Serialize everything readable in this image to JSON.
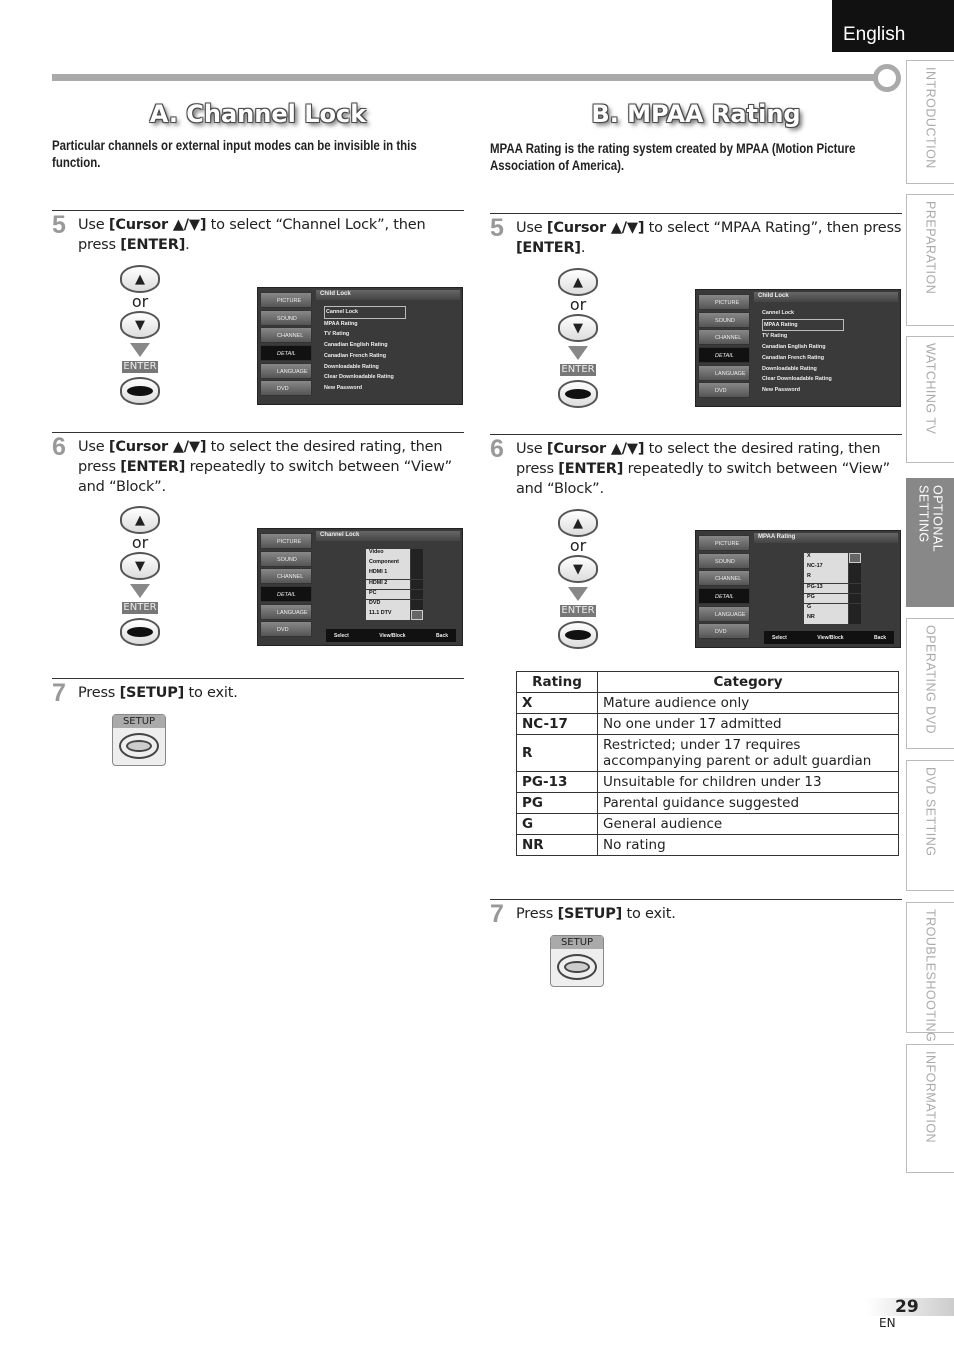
{
  "header": {
    "language": "English"
  },
  "side_tabs": [
    {
      "label": "INTRODUCTION",
      "active": false
    },
    {
      "label": "PREPARATION",
      "active": false
    },
    {
      "label": "WATCHING TV",
      "active": false
    },
    {
      "label": "OPTIONAL SETTING",
      "active": true
    },
    {
      "label": "OPERATING DVD",
      "active": false
    },
    {
      "label": "DVD SETTING",
      "active": false
    },
    {
      "label": "TROUBLESHOOTING",
      "active": false
    },
    {
      "label": "INFORMATION",
      "active": false
    }
  ],
  "remote": {
    "or": "or",
    "enter": "ENTER",
    "setup": "SETUP"
  },
  "menu_side": [
    "PICTURE",
    "SOUND",
    "CHANNEL",
    "DETAIL",
    "LANGUAGE",
    "DVD"
  ],
  "menu_footer": {
    "select": "Select",
    "viewblock": "View/Block",
    "back": "Back",
    "back_tag": "BACK"
  },
  "sectionA": {
    "title": "A.  Channel Lock",
    "intro": "Particular channels or external input modes can be invisible in this function.",
    "step5": {
      "num": "5",
      "pre": "Use ",
      "b1": "[Cursor ▲/▼]",
      "mid": " to select “Channel Lock”, then press ",
      "b2": "[ENTER]",
      "post": "."
    },
    "screen1": {
      "title": "Child Lock",
      "items": [
        "Cannel Lock",
        "MPAA Rating",
        "TV Rating",
        "Canadian English Rating",
        "Canadian French Rating",
        "Downloadable Rating",
        "Clear Downloadable Rating",
        "New Password"
      ]
    },
    "step6": {
      "num": "6",
      "pre": "Use ",
      "b1": "[Cursor ▲/▼]",
      "mid": " to select the desired rating, then press ",
      "b2": "[ENTER]",
      "post": " repeatedly to switch between “View” and “Block”."
    },
    "screen2": {
      "title": "Channel Lock",
      "items": [
        "Video",
        "Component",
        "HDMI 1",
        "HDMI 2",
        "PC",
        "DVD",
        "11.1 DTV"
      ]
    },
    "step7": {
      "num": "7",
      "pre": "Press ",
      "b1": "[SETUP]",
      "post": " to exit."
    }
  },
  "sectionB": {
    "title": "B. MPAA Rating",
    "intro": "MPAA Rating is the rating system created by MPAA (Motion Picture Association of America).",
    "step5": {
      "num": "5",
      "pre": "Use ",
      "b1": "[Cursor ▲/▼]",
      "mid": " to select “MPAA Rating”, then press ",
      "b2": "[ENTER]",
      "post": "."
    },
    "screen1": {
      "title": "Child Lock",
      "items": [
        "Cannel Lock",
        "MPAA Rating",
        "TV Rating",
        "Canadian English Rating",
        "Canadian French Rating",
        "Downloadable Rating",
        "Clear Downloadable Rating",
        "New Password"
      ]
    },
    "step6": {
      "num": "6",
      "pre": "Use ",
      "b1": "[Cursor ▲/▼]",
      "mid": " to select the desired rating, then press ",
      "b2": "[ENTER]",
      "post": " repeatedly to switch between “View” and “Block”."
    },
    "screen2": {
      "title": "MPAA Rating",
      "items": [
        "X",
        "NC-17",
        "R",
        "PG-13",
        "PG",
        "G",
        "NR"
      ]
    },
    "table": {
      "headers": [
        "Rating",
        "Category"
      ],
      "rows": [
        [
          "X",
          "Mature audience only"
        ],
        [
          "NC-17",
          "No one under 17 admitted"
        ],
        [
          "R",
          "Restricted; under 17 requires accompanying parent or adult guardian"
        ],
        [
          "PG-13",
          "Unsuitable for children under 13"
        ],
        [
          "PG",
          "Parental guidance suggested"
        ],
        [
          "G",
          "General audience"
        ],
        [
          "NR",
          "No rating"
        ]
      ]
    },
    "step7": {
      "num": "7",
      "pre": "Press ",
      "b1": "[SETUP]",
      "post": " to exit."
    }
  },
  "footer": {
    "page": "29",
    "lang": "EN"
  }
}
